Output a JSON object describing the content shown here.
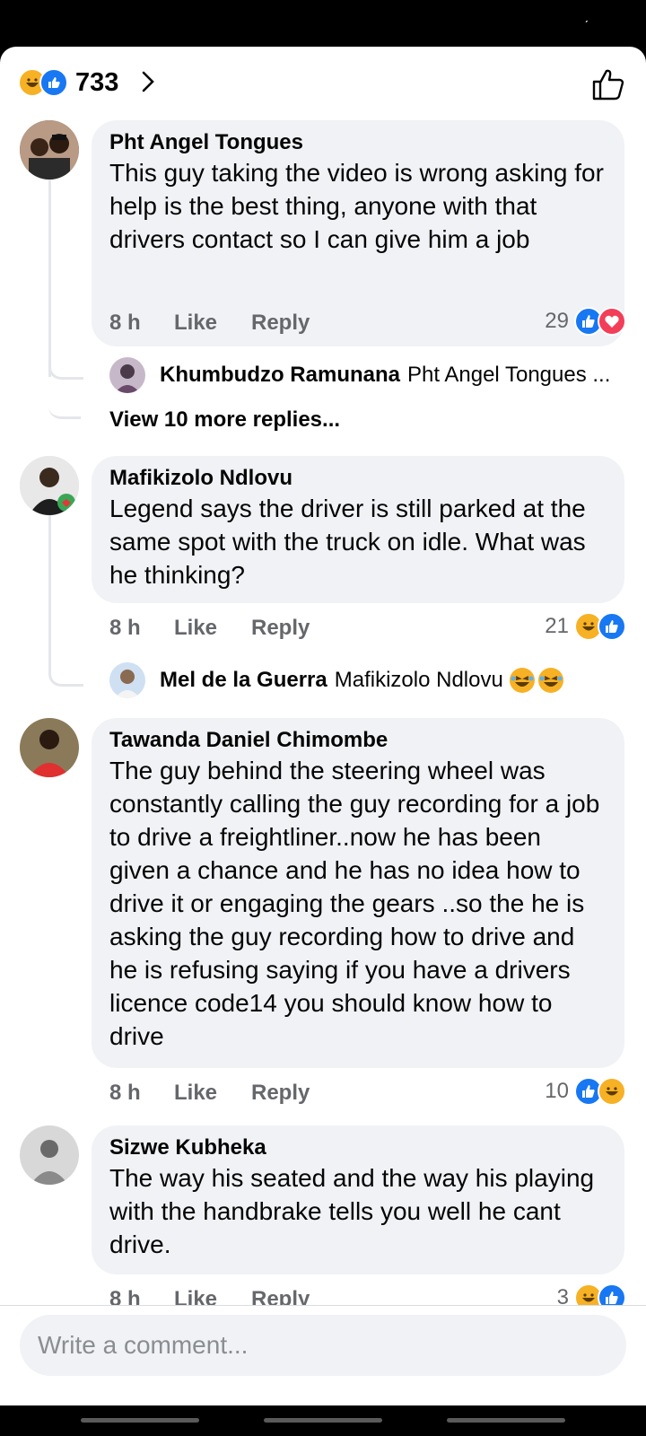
{
  "header": {
    "reaction_total": "733",
    "reaction_icons": [
      "haha-icon",
      "like-icon"
    ]
  },
  "comments": [
    {
      "author": "Pht Angel Tongues",
      "text": "This guy taking the video is wrong asking for help is the best  thing, anyone with that drivers contact so I can give him a job",
      "age": "8 h",
      "like_label": "Like",
      "reply_label": "Reply",
      "reaction_count": "29",
      "reaction_icons": [
        "like-icon",
        "love-icon"
      ],
      "replies": [
        {
          "author": "Khumbudzo Ramunana",
          "text": "Pht Angel Tongues ..."
        }
      ],
      "view_more": "View 10 more replies..."
    },
    {
      "author": "Mafikizolo Ndlovu",
      "text": "Legend says the driver is still parked at the same spot with the truck on idle. What was he thinking?",
      "age": "8 h",
      "like_label": "Like",
      "reply_label": "Reply",
      "reaction_count": "21",
      "reaction_icons": [
        "haha-icon",
        "like-icon"
      ],
      "replies": [
        {
          "author": "Mel de la Guerra",
          "text": "Mafikizolo Ndlovu",
          "emojis": [
            "laughing-emoji",
            "laughing-emoji"
          ]
        }
      ]
    },
    {
      "author": "Tawanda Daniel Chimombe",
      "text": "The guy behind the steering wheel was constantly calling the guy recording for a job to drive a freightliner..now he has been given a chance and he has no idea how to drive it or engaging the gears ..so the he is asking the guy recording how to drive and he is refusing saying if you have a drivers licence code14 you should know how to drive",
      "age": "8 h",
      "like_label": "Like",
      "reply_label": "Reply",
      "reaction_count": "10",
      "reaction_icons": [
        "like-icon",
        "haha-icon"
      ]
    },
    {
      "author": "Sizwe Kubheka",
      "text": "The way his seated and the way his playing with the handbrake tells you well he cant drive.",
      "age": "8 h",
      "like_label": "Like",
      "reply_label": "Reply",
      "reaction_count": "3",
      "reaction_icons": [
        "haha-icon",
        "like-icon"
      ]
    }
  ],
  "composer": {
    "placeholder": "Write a comment..."
  },
  "colors": {
    "like": "#1877f2",
    "love": "#f33e58",
    "haha": "#f7b125",
    "muted": "#65676b",
    "bubble": "#f0f2f5"
  }
}
